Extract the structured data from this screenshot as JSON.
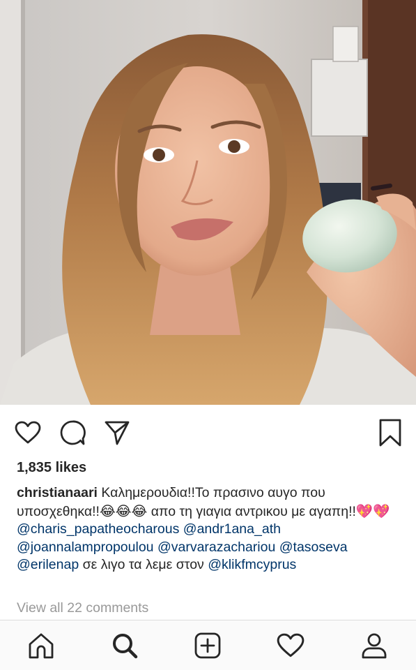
{
  "post": {
    "likes_text": "1,835 likes",
    "caption": {
      "username": "christianaari",
      "segments": [
        {
          "type": "text",
          "value": " Καλημερουδια!!Το πρασινο αυγο που υποσχεθηκα!!"
        },
        {
          "type": "emoji",
          "value": "😂😂😂"
        },
        {
          "type": "text",
          "value": " απο τη γιαγια αντρικου με αγαπη!!"
        },
        {
          "type": "emoji",
          "value": "💖💖"
        },
        {
          "type": "mention",
          "value": "@charis_papatheocharous"
        },
        {
          "type": "text",
          "value": " "
        },
        {
          "type": "mention",
          "value": "@andr1ana_ath"
        },
        {
          "type": "text",
          "value": " "
        },
        {
          "type": "mention",
          "value": "@joannalampropoulou"
        },
        {
          "type": "text",
          "value": " "
        },
        {
          "type": "mention",
          "value": "@varvarazachariou"
        },
        {
          "type": "text",
          "value": " "
        },
        {
          "type": "mention",
          "value": "@tasoseva"
        },
        {
          "type": "text",
          "value": " "
        },
        {
          "type": "mention",
          "value": "@erilenap"
        },
        {
          "type": "text",
          "value": " σε λιγο τα λεμε στον "
        },
        {
          "type": "mention",
          "value": "@klikfmcyprus"
        }
      ]
    },
    "view_comments_text": "View all 22 comments"
  },
  "icons": {
    "like": "heart-icon",
    "comment": "comment-icon",
    "share": "paper-plane-icon",
    "save": "bookmark-icon"
  },
  "bottom_nav": [
    "home-icon",
    "search-icon",
    "add-post-icon",
    "activity-heart-icon",
    "profile-icon"
  ],
  "colors": {
    "text": "#262626",
    "mention": "#003569",
    "muted": "#999999",
    "nav_background": "#fafafa",
    "divider": "#dbdbdb"
  }
}
